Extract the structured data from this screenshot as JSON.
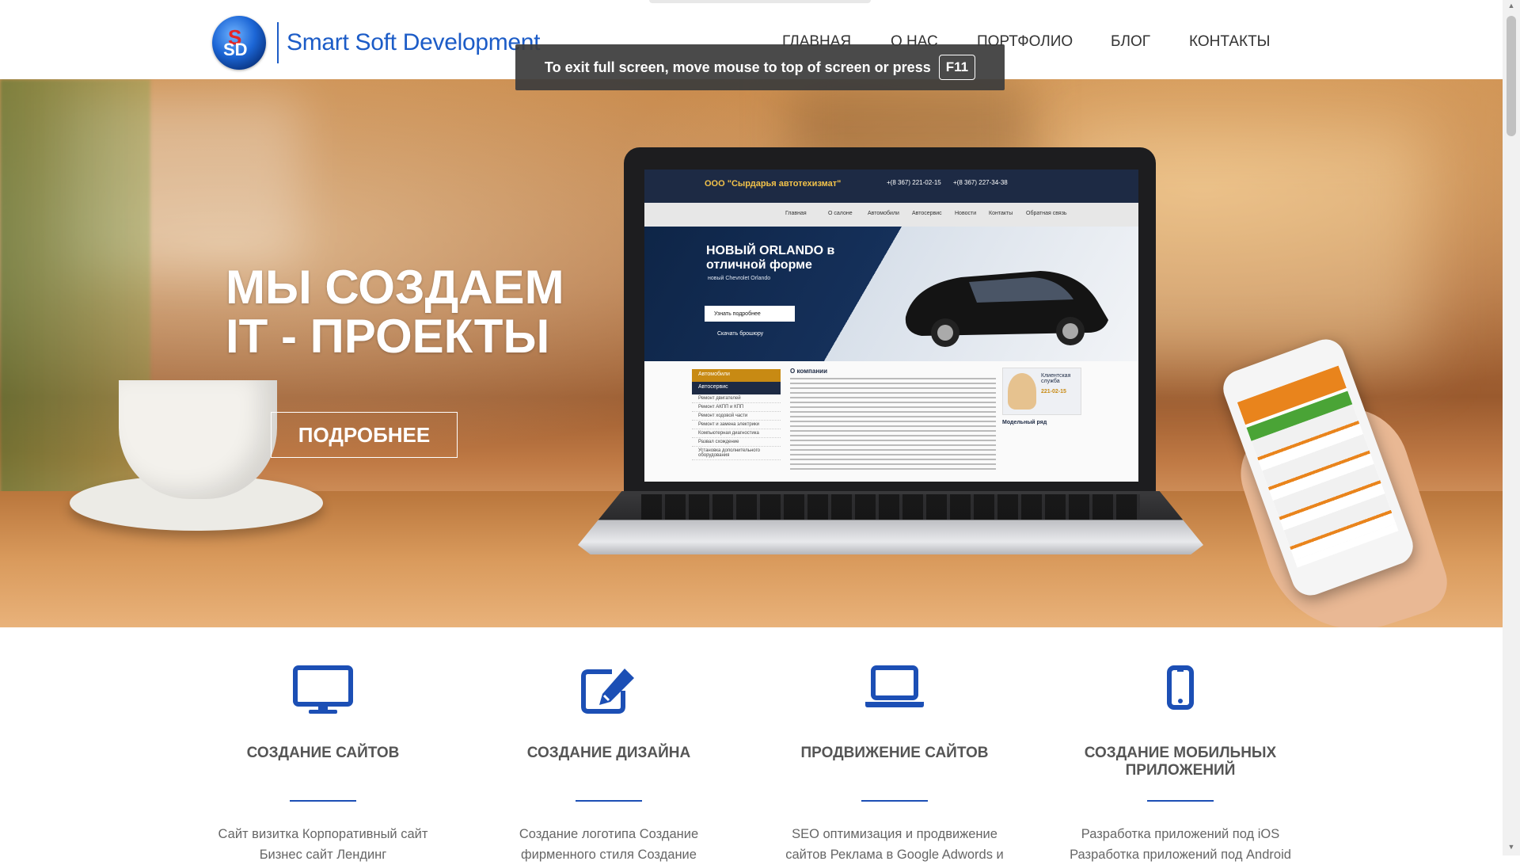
{
  "header": {
    "logo_text": "Smart Soft Development",
    "nav": [
      "ГЛАВНАЯ",
      "О НАС",
      "ПОРТФОЛИО",
      "БЛОГ",
      "КОНТАКТЫ"
    ]
  },
  "fullscreen_notice": {
    "text": "To exit full screen, move mouse to top of screen or press",
    "key": "F11"
  },
  "hero": {
    "title_line1": "МЫ СОЗДАЕМ",
    "title_line2": "IT - ПРОЕКТЫ",
    "button": "ПОДРОБНЕЕ",
    "laptop_screen": {
      "brand": "ООО \"Сырдарья автотехизмат\"",
      "phone1": "+(8 367) 221-02-15",
      "phone2": "+(8 367) 227-34-38",
      "nav": [
        "Главная",
        "О салоне",
        "Автомобили",
        "Автосервис",
        "Новости",
        "Контакты",
        "Обратная связь"
      ],
      "banner_title_1": "НОВЫЙ ORLANDO в",
      "banner_title_2": "отличной форме",
      "banner_sub": "новый Chevrolet Orlando",
      "banner_button": "Узнать подробнее",
      "banner_download": "Скачать брошюру",
      "side_active_1": "Автомобили",
      "side_active_2": "Автосервис",
      "side_items": [
        "Ремонт двигателей",
        "Ремонт АКПП и КПП",
        "Ремонт ходовой части",
        "Ремонт и замена электрики",
        "Компьютерная диагностика",
        "Развал схождение",
        "Установка дополнительного оборудования"
      ],
      "about_title": "О компании",
      "support_label": "Клиентская служба",
      "support_phone": "221-02-15",
      "models_title": "Модельный ряд"
    }
  },
  "services": [
    {
      "icon": "monitor-icon",
      "title": "СОЗДАНИЕ САЙТОВ",
      "text": "Сайт визитка Корпоративный сайт Бизнес сайт Лендинг"
    },
    {
      "icon": "edit-icon",
      "title": "СОЗДАНИЕ ДИЗАЙНА",
      "text": "Создание логотипа Создание фирменного стиля Создание"
    },
    {
      "icon": "laptop-icon",
      "title": "ПРОДВИЖЕНИЕ САЙТОВ",
      "text": "SEO оптимизация и продвижение сайтов Реклама в Google Adwords и"
    },
    {
      "icon": "mobile-icon",
      "title": "СОЗДАНИЕ МОБИЛЬНЫХ ПРИЛОЖЕНИЙ",
      "text": "Разработка приложений под iOS Разработка приложений под Android"
    }
  ],
  "colors": {
    "accent": "#1c4fb5",
    "logo_blue": "#1c5cc7",
    "title_gray": "#555555"
  }
}
